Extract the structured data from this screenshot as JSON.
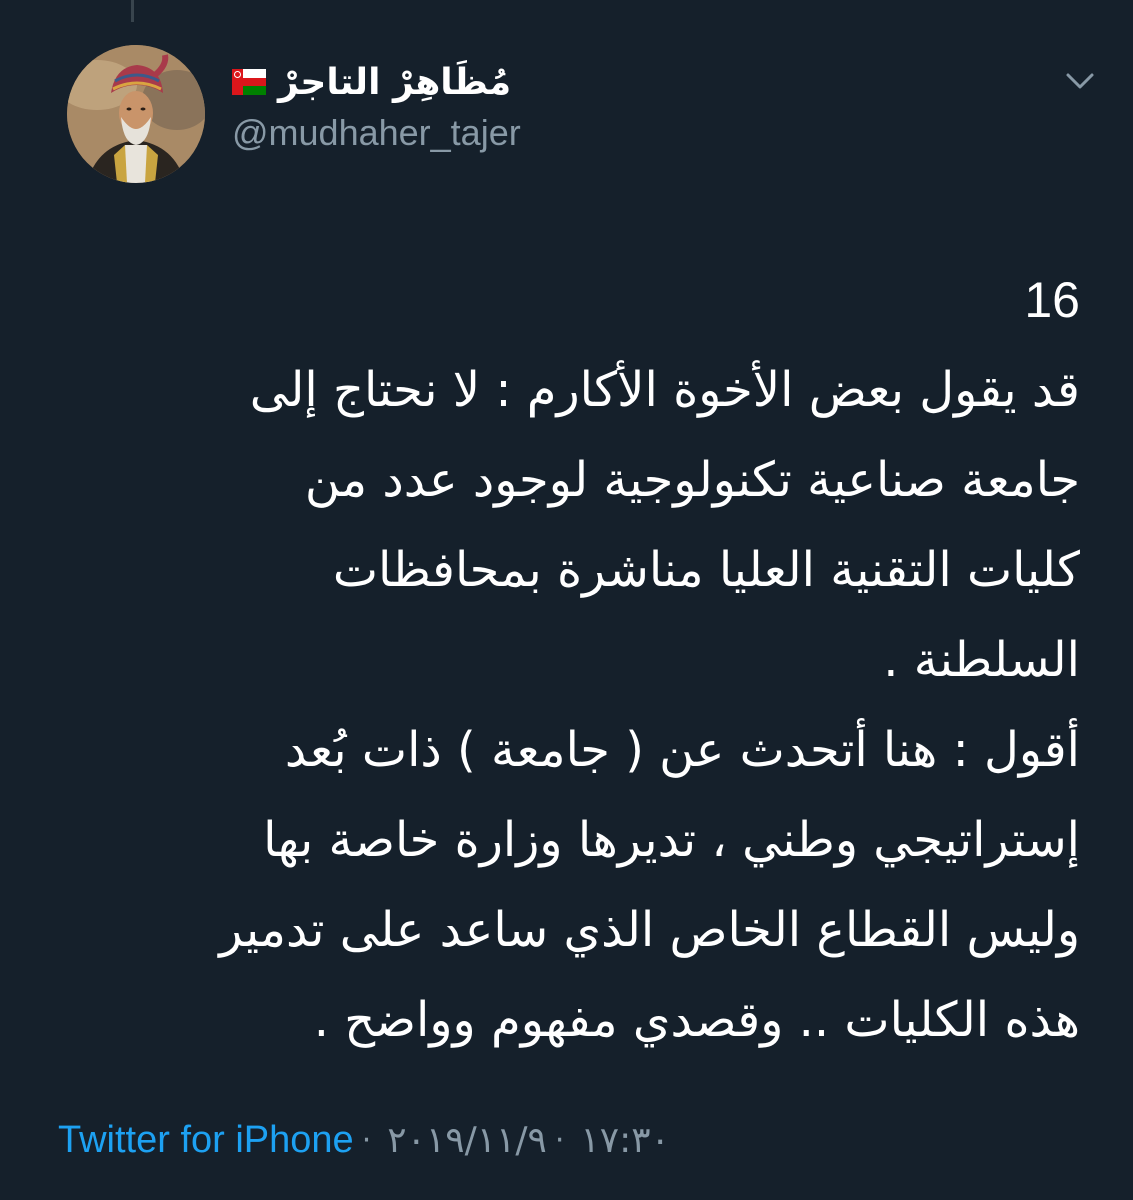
{
  "author": {
    "display_name": "مُظَاهِرْ التاجرْ",
    "handle": "@mudhaher_tajer",
    "flag": "oman-flag-icon"
  },
  "tweet": {
    "lines": [
      "16",
      "قد يقول بعض الأخوة الأكارم : لا نحتاج إلى",
      "جامعة صناعية تكنولوجية لوجود عدد من",
      "كليات التقنية العليا مناشرة بمحافظات",
      "السلطنة .",
      "أقول : هنا أتحدث عن ( جامعة ) ذات بُعد",
      "إستراتيجي وطني ، تديرها وزارة خاصة بها",
      "وليس القطاع الخاص الذي ساعد على تدمير",
      "هذه الكليات .. وقصدي مفهوم وواضح ."
    ]
  },
  "footer": {
    "source": "Twitter for iPhone",
    "separator": "·",
    "date": "٢٠١٩/١١/٩",
    "time": "١٧:٣٠"
  },
  "colors": {
    "background": "#15202b",
    "text": "#ffffff",
    "secondary": "#8899a6",
    "link": "#1da1f2"
  },
  "icons": {
    "more_menu": "chevron-down-icon"
  }
}
